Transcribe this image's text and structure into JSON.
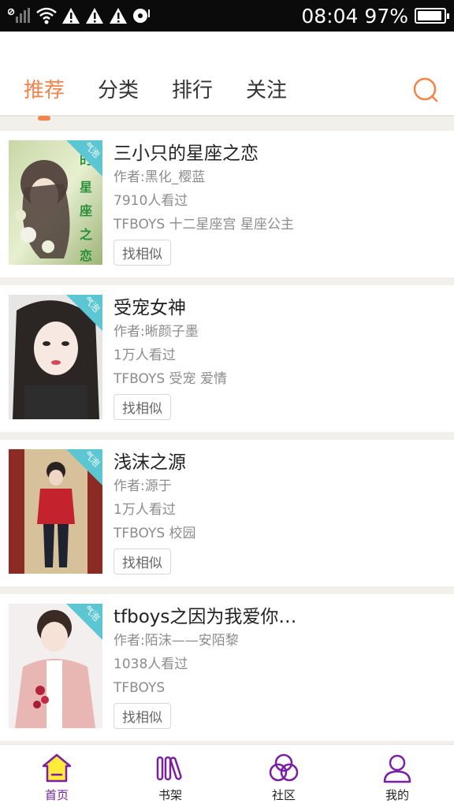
{
  "status_bar": {
    "time": "08:04",
    "battery_percent": "97%",
    "battery_level": 0.97
  },
  "tabs": [
    {
      "label": "推荐",
      "active": true
    },
    {
      "label": "分类",
      "active": false
    },
    {
      "label": "排行",
      "active": false
    },
    {
      "label": "关注",
      "active": false
    }
  ],
  "search": {
    "icon": "search-icon"
  },
  "corner_badge": "气泡",
  "books": [
    {
      "title": "三小只的星座之恋",
      "author": "作者:黑化_樱蓝",
      "views": "7910人看过",
      "tags": "TFBOYS 十二星座宫 星座公主",
      "similar": "找相似"
    },
    {
      "title": "受宠女神",
      "author": "作者:晰颜子墨",
      "views": "1万人看过",
      "tags": "TFBOYS 受宠 爱情",
      "similar": "找相似"
    },
    {
      "title": "浅沫之源",
      "author": "作者:源于",
      "views": "1万人看过",
      "tags": "TFBOYS 校园",
      "similar": "找相似"
    },
    {
      "title": "tfboys之因为我爱你…",
      "author": "作者:陌沫——安陌黎",
      "views": "1038人看过",
      "tags": "TFBOYS",
      "similar": "找相似"
    }
  ],
  "bottom_nav": [
    {
      "label": "首页",
      "icon": "home-icon",
      "active": true
    },
    {
      "label": "书架",
      "icon": "bookshelf-icon",
      "active": false
    },
    {
      "label": "社区",
      "icon": "community-icon",
      "active": false
    },
    {
      "label": "我的",
      "icon": "profile-icon",
      "active": false
    }
  ],
  "colors": {
    "accent": "#f5834a",
    "nav_active": "#7b1fa2",
    "badge": "#5cc6d3"
  }
}
